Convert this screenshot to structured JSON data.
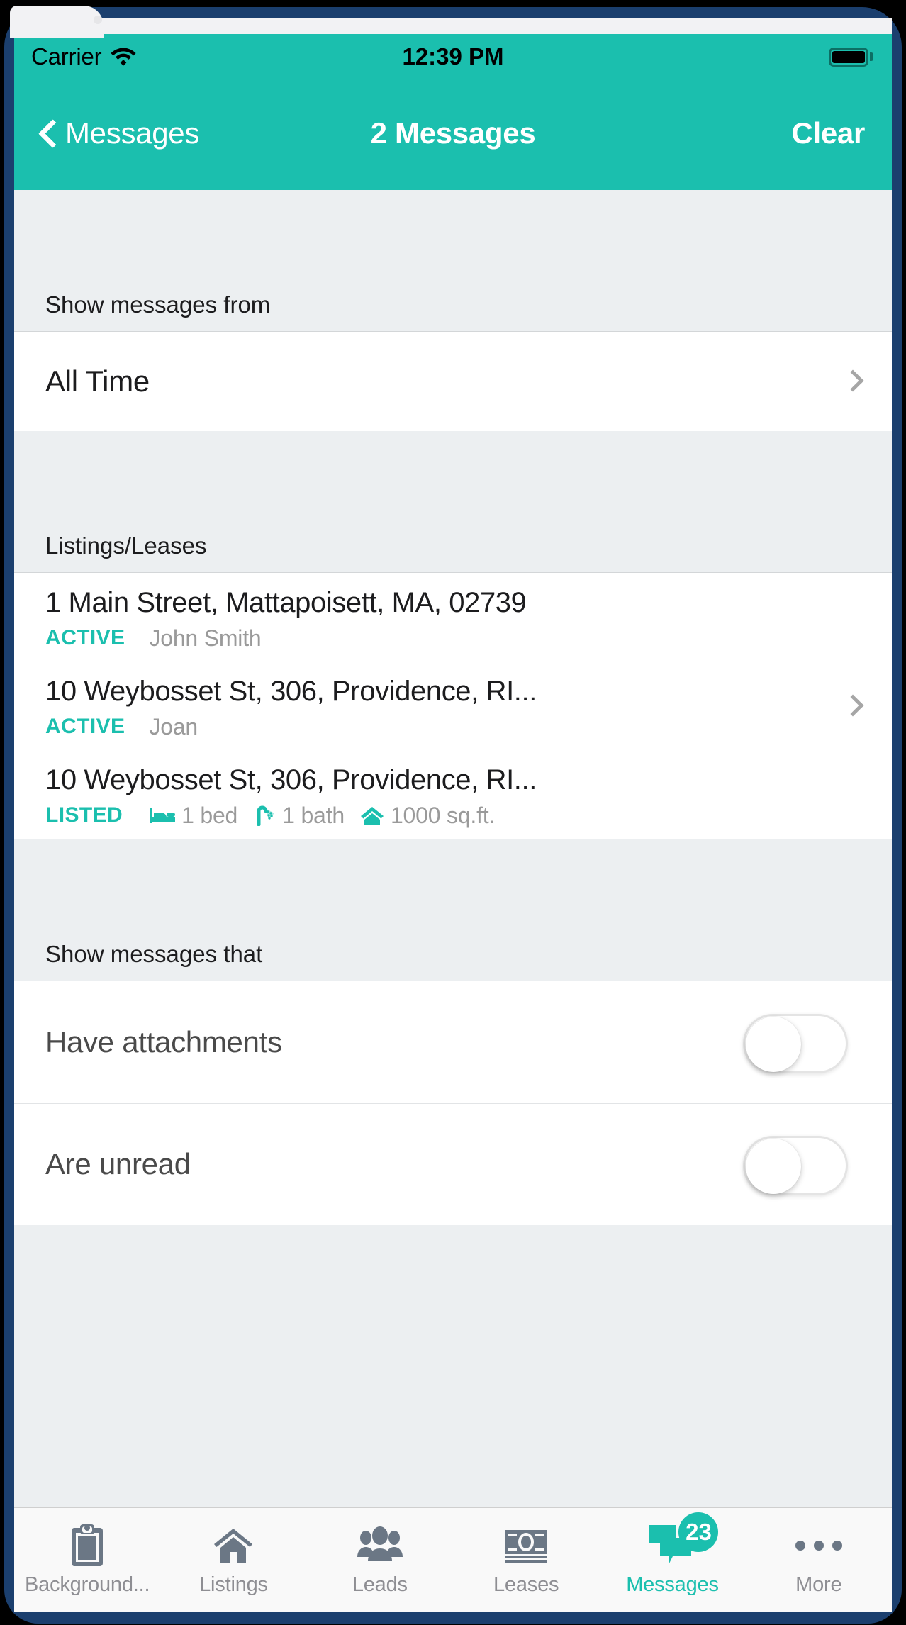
{
  "status_bar": {
    "carrier": "Carrier",
    "wifi_icon": "wifi-icon",
    "time": "12:39 PM",
    "battery_icon": "battery-full-icon"
  },
  "nav_bar": {
    "back_label": "Messages",
    "back_icon": "chevron-left-icon",
    "title": "2 Messages",
    "clear_label": "Clear"
  },
  "filters": {
    "time_section": {
      "header": "Show messages from",
      "selected_value": "All Time",
      "disclosure_icon": "chevron-right-icon"
    },
    "listings_section": {
      "header": "Listings/Leases",
      "disclosure_icon": "chevron-right-icon",
      "items": [
        {
          "address": "1 Main Street, Mattapoisett, MA, 02739",
          "status": "ACTIVE",
          "person": "John Smith",
          "stats": []
        },
        {
          "address": "10 Weybosset St, 306, Providence, RI...",
          "status": "ACTIVE",
          "person": "Joan",
          "stats": []
        },
        {
          "address": "10 Weybosset St, 306, Providence, RI...",
          "status": "LISTED",
          "person": "",
          "stats": [
            {
              "icon": "bed-icon",
              "text": "1 bed"
            },
            {
              "icon": "shower-icon",
              "text": "1 bath"
            },
            {
              "icon": "house-icon",
              "text": "1000 sq.ft."
            }
          ]
        }
      ]
    },
    "toggles_section": {
      "header": "Show messages that",
      "rows": [
        {
          "label": "Have attachments",
          "value": "off"
        },
        {
          "label": "Are unread",
          "value": "off"
        }
      ]
    }
  },
  "tab_bar": {
    "items": [
      {
        "label": "Background...",
        "icon": "clipboard-icon",
        "active": false,
        "badge": ""
      },
      {
        "label": "Listings",
        "icon": "house-icon",
        "active": false,
        "badge": ""
      },
      {
        "label": "Leads",
        "icon": "people-icon",
        "active": false,
        "badge": ""
      },
      {
        "label": "Leases",
        "icon": "money-icon",
        "active": false,
        "badge": ""
      },
      {
        "label": "Messages",
        "icon": "chat-bubbles-icon",
        "active": true,
        "badge": "23"
      },
      {
        "label": "More",
        "icon": "ellipsis-icon",
        "active": false,
        "badge": ""
      }
    ]
  },
  "colors": {
    "accent_teal": "#1bbfae",
    "bezel_navy": "#1b3f6e",
    "group_background": "#eceff1",
    "cell_background": "#ffffff",
    "muted_text": "#9a9a9a",
    "tab_inactive": "#8e8e93"
  }
}
